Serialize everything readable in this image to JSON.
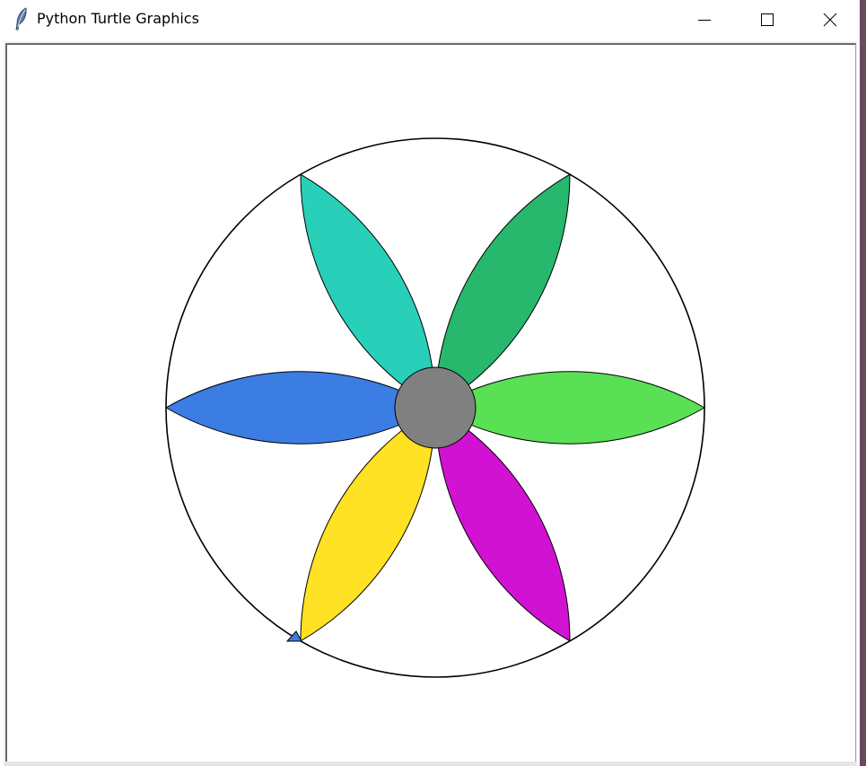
{
  "window": {
    "title": "Python Turtle Graphics",
    "icon": "feather-icon",
    "controls": {
      "minimize_icon": "minimize-icon",
      "maximize_icon": "maximize-icon",
      "close_icon": "close-icon"
    }
  },
  "drawing": {
    "outer_circle": {
      "stroke": "#000000",
      "fill": "none"
    },
    "petals": [
      {
        "name": "petal-right",
        "angle_deg": 0,
        "fill": "#59e055"
      },
      {
        "name": "petal-upper-right",
        "angle_deg": 60,
        "fill": "#27b76d"
      },
      {
        "name": "petal-upper-left",
        "angle_deg": 120,
        "fill": "#29d0b9"
      },
      {
        "name": "petal-left",
        "angle_deg": 180,
        "fill": "#3b7de3"
      },
      {
        "name": "petal-lower-left",
        "angle_deg": 240,
        "fill": "#ffe223"
      },
      {
        "name": "petal-lower-right",
        "angle_deg": 300,
        "fill": "#d212d2"
      }
    ],
    "center_disc": {
      "fill": "#808080",
      "stroke": "#000000"
    },
    "turtle_cursor": {
      "fill": "#3b7de3",
      "stroke": "#000000",
      "heading_deg": 0
    }
  }
}
